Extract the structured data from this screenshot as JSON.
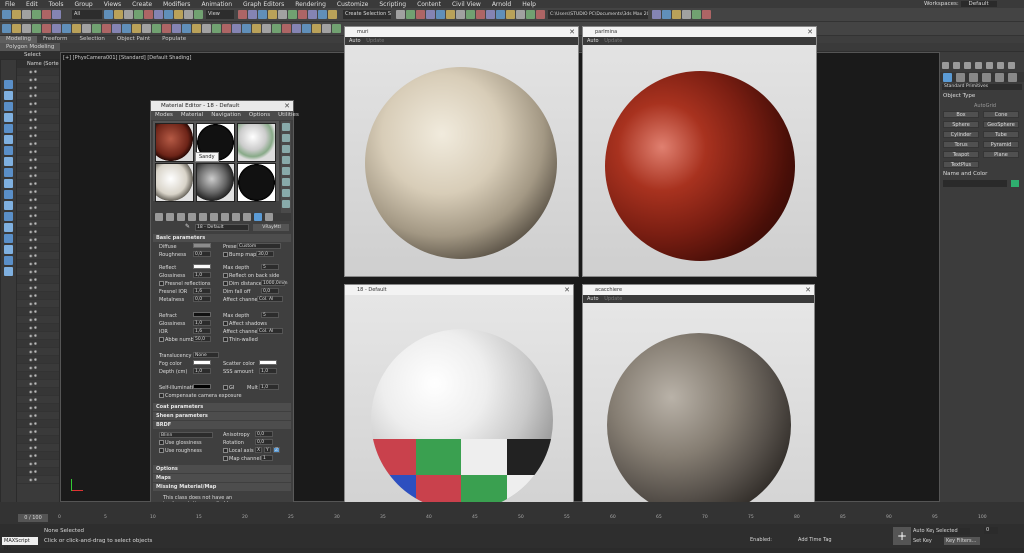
{
  "menu": [
    "File",
    "Edit",
    "Tools",
    "Group",
    "Views",
    "Create",
    "Modifiers",
    "Animation",
    "Graph Editors",
    "Rendering",
    "Customize",
    "Scripting",
    "Content",
    "Civil View",
    "Arnold",
    "Help"
  ],
  "workspace": {
    "label": "Workspaces:",
    "value": "Default"
  },
  "toolbar": {
    "filter": "All",
    "view": "View",
    "selection_set": "Create Selection Se",
    "path": "C:\\Users\\STUDIO PC\\Documents\\3ds Max 2023"
  },
  "ribbon": {
    "tabs": [
      "Modeling",
      "Freeform",
      "Selection",
      "Object Paint",
      "Populate"
    ],
    "active": "Modeling",
    "sub": "Polygon Modeling"
  },
  "select_label": "Select",
  "scene_header": "Name (Sorted",
  "viewport_label": "[+] [PhysCamera001] [Standard] [Default Shading]",
  "material_editor": {
    "title": "Material Editor - 18 - Default",
    "menu": [
      "Modes",
      "Material",
      "Navigation",
      "Options",
      "Utilities"
    ],
    "tooltip": "Sandy",
    "mat_name": "18 - Default",
    "mat_type": "VRayMtl",
    "basic_params": "Basic parameters",
    "diffuse": "Diffuse",
    "roughness": "Roughness",
    "roughness_val": "0,0",
    "preset": "Preset",
    "preset_val": "Custom",
    "bump_map": "Bump map",
    "bump_val": "30,0",
    "reflect": "Reflect",
    "glossiness": "Glossiness",
    "gloss_val": "1,0",
    "max_depth": "Max depth",
    "max_depth_val": "5",
    "back_side": "Reflect on back side",
    "fresnel": "Fresnel reflections",
    "dim_distance": "Dim distance",
    "dim_val": "1000,0mm",
    "fresnel_ior": "Fresnel IOR",
    "fresnel_ior_val": "1,6",
    "dim_falloff": "Dim fall off",
    "dim_falloff_val": "0,0",
    "metalness": "Metalness",
    "metalness_val": "0,0",
    "affect_channels": "Affect channels",
    "affect_val": "Col. Al",
    "refract": "Refract",
    "r_gloss": "Glossiness",
    "r_gloss_val": "1,0",
    "r_depth": "Max depth",
    "r_depth_val": "5",
    "affect_shadows": "Affect shadows",
    "ior": "IOR",
    "ior_val": "1,6",
    "r_affect": "Affect channels",
    "r_affect_val": "Col. Al",
    "abbe": "Abbe number",
    "abbe_val": "50,0",
    "thin": "Thin-walled",
    "translucency": "Translucency",
    "transl_val": "None",
    "fog_color": "Fog color",
    "scatter": "Scatter color",
    "depth": "Depth (cm)",
    "depth_val": "1,0",
    "sss": "SSS amount",
    "sss_val": "1,0",
    "self_illum": "Self-illumination",
    "gi": "GI",
    "mult": "Mult",
    "mult_val": "1,0",
    "comp": "Compensate camera exposure",
    "coat": "Coat parameters",
    "sheen": "Sheen parameters",
    "brdf": "BRDF",
    "brdf_type": "Blinn",
    "anisotropy": "Anisotropy",
    "aniso_val": "0,0",
    "rotation": "Rotation",
    "rot_val": "0,0",
    "use_gloss": "Use glossiness",
    "use_rough": "Use roughness",
    "local_axis": "Local axis",
    "axes": [
      "X",
      "Y",
      "Z"
    ],
    "map_channel": "Map channel",
    "map_val": "1",
    "options": "Options",
    "maps": "Maps",
    "missing": "Missing Material/Map",
    "missing_text": "This class does not have an implementation supplied by"
  },
  "previews": [
    {
      "title": "muri",
      "auto": "Auto",
      "update": "Update"
    },
    {
      "title": "parlmina",
      "auto": "Auto",
      "update": "Update"
    },
    {
      "title": "18 - Default",
      "auto": "Auto",
      "update": "Update"
    },
    {
      "title": "acacchiere",
      "auto": "Auto",
      "update": "Update"
    }
  ],
  "cmd_panel": {
    "dropdown": "Standard Primitives",
    "object_type": "Object Type",
    "autogrid": "AutoGrid",
    "buttons": [
      "Box",
      "Cone",
      "Sphere",
      "GeoSphere",
      "Cylinder",
      "Tube",
      "Torus",
      "Pyramid",
      "Teapot",
      "Plane",
      "TextPlus"
    ],
    "name_color": "Name and Color"
  },
  "timeline": {
    "frame": "0 / 100",
    "ticks": [
      "0",
      "5",
      "10",
      "15",
      "20",
      "25",
      "30",
      "35",
      "40",
      "45",
      "50",
      "55",
      "60",
      "65",
      "70",
      "75",
      "80",
      "85",
      "90",
      "95",
      "100"
    ]
  },
  "status": {
    "selected": "None Selected",
    "hint": "Click or click-and-drag to select objects",
    "script": "MAXScript Mi:",
    "enabled": "Enabled:",
    "add_time_tag": "Add Time Tag",
    "auto_key": "Auto Key",
    "selected_val": "Selected",
    "set_key": "Set Key",
    "key_filters": "Key Filters...",
    "frame_val": "0"
  },
  "colors": {
    "accent": "#5b9bd5",
    "dark_bg": "#1a1a1a",
    "panel": "#3c3c3c"
  }
}
